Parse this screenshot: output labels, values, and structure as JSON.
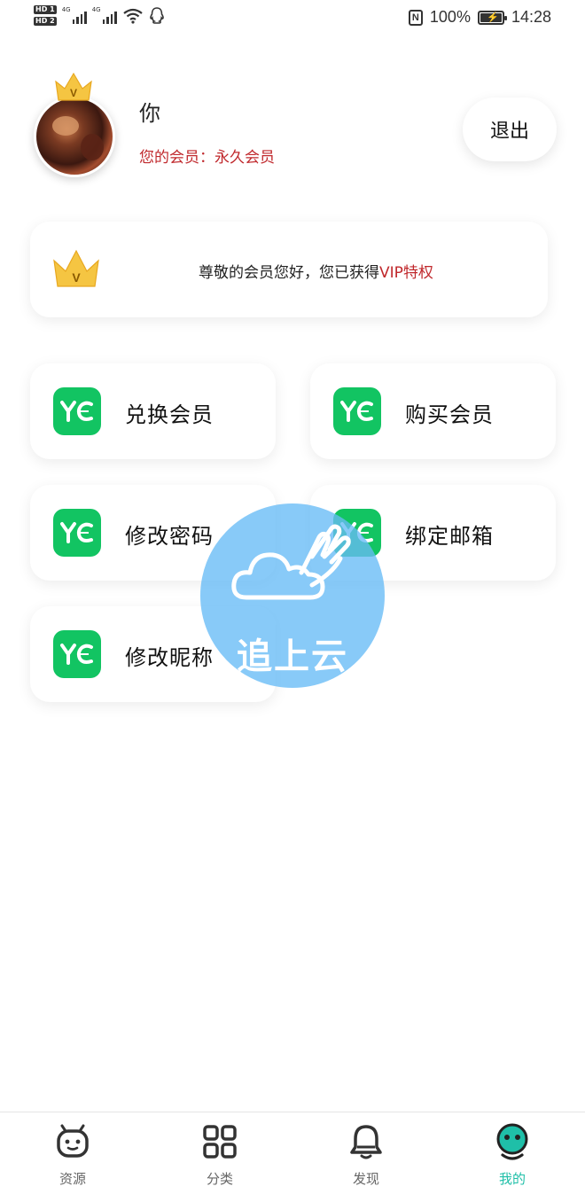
{
  "status_bar": {
    "hd1": "HD 1",
    "hd2": "HD 2",
    "net1": "4G",
    "net2": "4G",
    "nfc": "N",
    "battery_level_percent": 100,
    "battery_text": "100%",
    "time": "14:28"
  },
  "profile": {
    "username": "你",
    "membership_text": "您的会员：永久会员",
    "logout_label": "退出",
    "crown_letter": "V",
    "avatar_icon": "avatar-photo"
  },
  "vip_banner": {
    "text_before": "尊敬的会员您好，您已获得",
    "text_highlight": "VIP特权",
    "crown_letter": "V"
  },
  "actions": [
    {
      "label": "兑换会员",
      "icon": "yc-logo-icon"
    },
    {
      "label": "购买会员",
      "icon": "yc-logo-icon"
    },
    {
      "label": "修改密码",
      "icon": "yc-logo-icon"
    },
    {
      "label": "绑定邮箱",
      "icon": "yc-logo-icon"
    },
    {
      "label": "修改昵称",
      "icon": "yc-logo-icon"
    }
  ],
  "watermark": {
    "text": "追上云",
    "icon": "cloud-hand-icon"
  },
  "bottom_nav": [
    {
      "label": "资源",
      "icon": "robot-icon",
      "active": false
    },
    {
      "label": "分类",
      "icon": "grid-icon",
      "active": false
    },
    {
      "label": "发现",
      "icon": "bell-icon",
      "active": false
    },
    {
      "label": "我的",
      "icon": "user-face-icon",
      "active": true
    }
  ],
  "colors": {
    "accent_red": "#c0282c",
    "brand_green": "#12c462",
    "crown_gold": "#f5c542",
    "nav_active": "#1fbfa8",
    "watermark_blue": "#66bbf6"
  }
}
